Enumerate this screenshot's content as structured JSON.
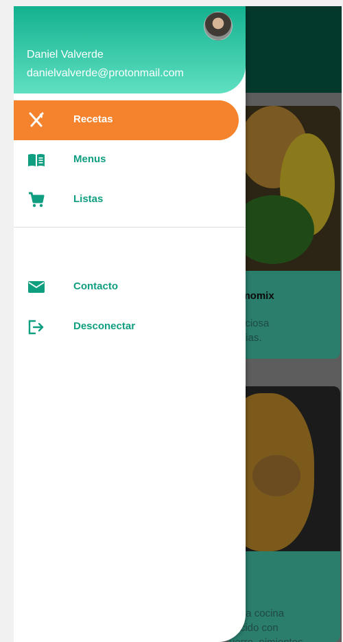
{
  "user": {
    "name": "Daniel Valverde",
    "email": "danielvalverde@protonmail.com"
  },
  "menu": {
    "primary": [
      {
        "label": "Recetas",
        "icon": "utensils-icon",
        "active": true
      },
      {
        "label": "Menus",
        "icon": "book-icon",
        "active": false
      },
      {
        "label": "Listas",
        "icon": "cart-icon",
        "active": false
      }
    ],
    "secondary": [
      {
        "label": "Contacto",
        "icon": "mail-icon"
      },
      {
        "label": "Desconectar",
        "icon": "logout-icon"
      }
    ]
  },
  "background": {
    "card1_title": "hermomix",
    "card1_text_lines": [
      "deliciosa",
      "pecias."
    ],
    "card2_text_lines": [
      "de la cocina",
      "cocido con",
      "uerro, pimientos,"
    ]
  },
  "colors": {
    "accent": "#f5822c",
    "primary": "#109e80",
    "header_gradient_top": "#13b18f",
    "header_gradient_bottom": "#5fe0c1"
  }
}
